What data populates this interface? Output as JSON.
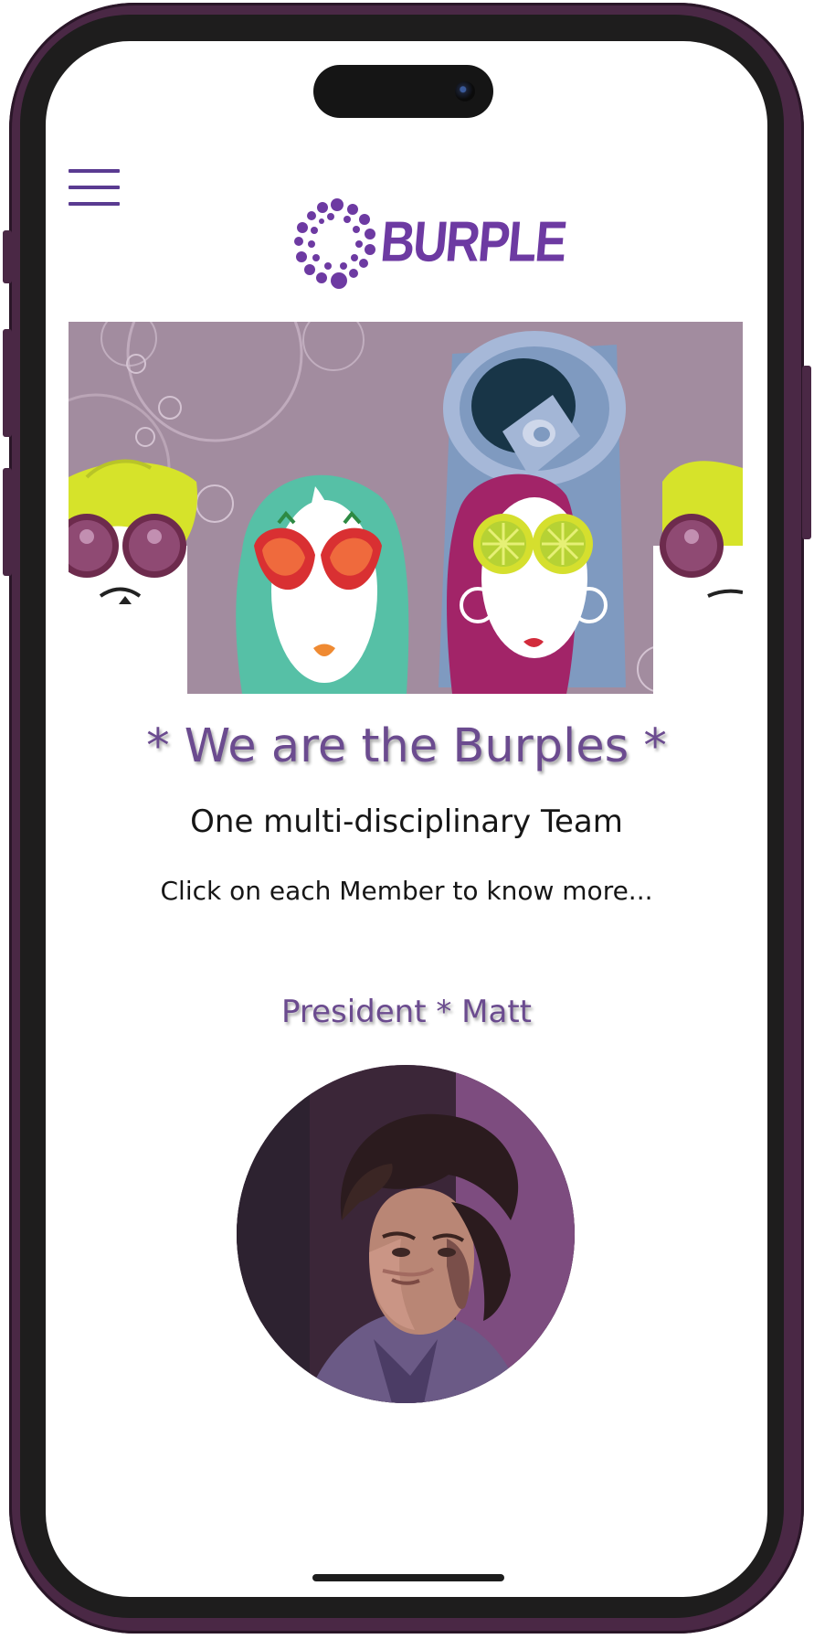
{
  "app": {
    "brand_name": "BURPLE"
  },
  "nav": {
    "menu_icon": "hamburger-menu-icon"
  },
  "hero": {
    "image_name": "burple-characters-banner"
  },
  "content": {
    "headline": "* We are the Burples *",
    "subtitle": "One multi-disciplinary Team",
    "instruction": "Click on each Member to know more..."
  },
  "member": {
    "title": "President * Matt",
    "photo_name": "member-photo-matt"
  },
  "colors": {
    "brand_purple": "#6d3aa2",
    "heading_purple": "#6b4b8f",
    "frame_purple": "#4a2845"
  }
}
